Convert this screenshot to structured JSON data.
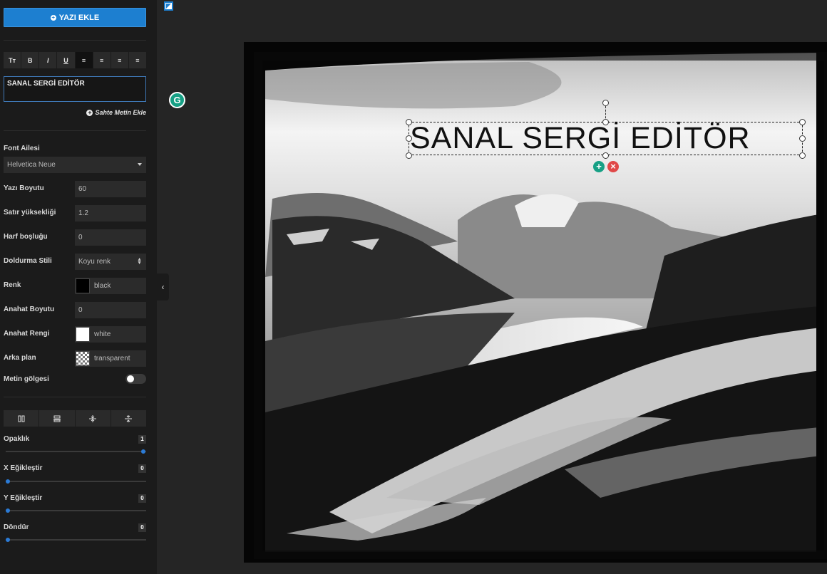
{
  "sidebar": {
    "add_text_button": "YAZI EKLE",
    "toolbar": [
      "Tт",
      "B",
      "I",
      "U",
      "≡",
      "≡",
      "≡",
      "≡"
    ],
    "text_value": "SANAL SERGİ EDİTÖR",
    "fake_text_link": "Sahte Metin Ekle",
    "font_family_label": "Font Ailesi",
    "font_family_value": "Helvetica Neue",
    "font_size_label": "Yazı Boyutu",
    "font_size_value": "60",
    "line_height_label": "Satır yüksekliği",
    "line_height_value": "1.2",
    "letter_spacing_label": "Harf boşluğu",
    "letter_spacing_value": "0",
    "fill_style_label": "Doldurma Stili",
    "fill_style_value": "Koyu renk",
    "color_label": "Renk",
    "color_value": "black",
    "outline_size_label": "Anahat Boyutu",
    "outline_size_value": "0",
    "outline_color_label": "Anahat Rengi",
    "outline_color_value": "white",
    "background_label": "Arka plan",
    "background_value": "transparent",
    "text_shadow_label": "Metin gölgesi",
    "text_shadow_on": false,
    "opacity_label": "Opaklık",
    "opacity_value": "1",
    "skew_x_label": "X Eğikleştir",
    "skew_x_value": "0",
    "skew_y_label": "Y Eğikleştir",
    "skew_y_value": "0",
    "rotate_label": "Döndür",
    "rotate_value": "0"
  },
  "canvas": {
    "text": "SANAL SERGİ EDİTÖR",
    "add_control": "+",
    "remove_control": "×"
  },
  "colors": {
    "accent": "#1d7fd0",
    "add_control": "#16a085",
    "remove_control": "#e04848"
  },
  "icons": {
    "grammarly": "G",
    "collapse": "‹"
  }
}
